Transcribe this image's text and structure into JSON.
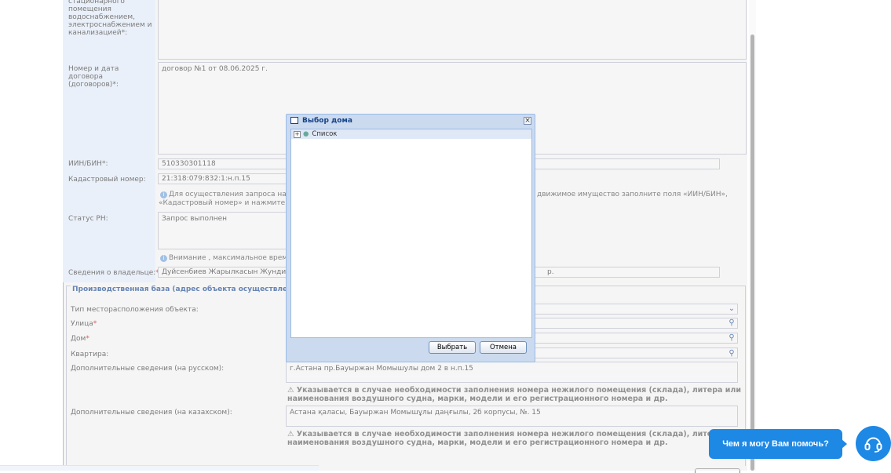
{
  "form": {
    "label_utilities": "стационарного помещения водоснабжением, электроснабжением и канализацией*:",
    "label_contract": "Номер и дата договора (договоров)*:",
    "contract_value": "договор №1 от 08.06.2025 г.",
    "label_iin": "ИИН/БИН*:",
    "iin_value": "510330301118",
    "label_cadastral": "Кадастровый номер:",
    "cadastral_value": "21:318:079:832:1:н.п.15",
    "info_note_left": "Для осуществления запроса на п",
    "info_note_left_2": "«Кадастровый номер» и нажмите на",
    "info_note_right": "движимое имущество заполните поля «ИИН/БИН»,",
    "label_status": "Статус РН:",
    "status_value": "Запрос выполнен",
    "attention_note": "Внимание , максимальное время",
    "label_owner": "Сведения о владельце:",
    "owner_value": "Дуйсенбиев Жарылкасын Жундибае",
    "owner_value_tail": "р."
  },
  "production": {
    "section_title": "Производственная база (адрес объекта осуществления дея",
    "label_location_type": "Тип месторасположения объекта:",
    "label_street": "Улица",
    "label_house": "Дом",
    "label_apartment": "Квартира:",
    "label_extra_ru": "Дополнительные сведения (на русском):",
    "extra_ru_value": "г.Астана пр.Бауыржан Момышулы дом 2 в н.п.15",
    "warn_ru_1": "Указывается в случае необходимости заполнения номера нежилого помещения (склада), литера или",
    "warn_ru_2": "наименования воздушного судна, марки, модели и его регистрационного номера и др.",
    "label_extra_kz": "Дополнительные сведения (на казахском):",
    "extra_kz_value": "Астана қаласы, Бауыржан Момышұлы даңғылы, 2б корпусы, №. 15",
    "warn_kz_1": "Указывается в случае необходимости заполнения номера нежилого помещения (склада), литера или",
    "warn_kz_2": "наименования воздушного судна, марки, модели и его регистрационного номера и др."
  },
  "dialog": {
    "title": "Выбор дома",
    "tree_root": "Список",
    "select_button": "Выбрать",
    "cancel_button": "Отмена"
  },
  "chat": {
    "prompt": "Чем я могу Вам помочь?"
  },
  "colors": {
    "accent": "#1e88e5",
    "header_blue": "#15428b",
    "required": "#cc0000"
  }
}
